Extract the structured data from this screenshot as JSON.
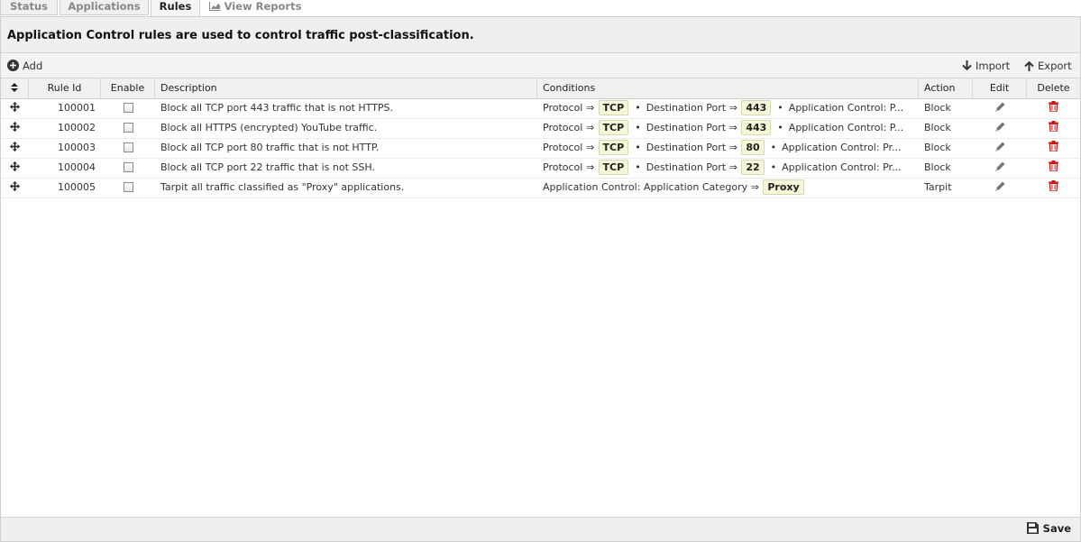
{
  "tabs": [
    {
      "label": "Status"
    },
    {
      "label": "Applications"
    },
    {
      "label": "Rules"
    },
    {
      "label": "View Reports",
      "icon": "chart-icon"
    }
  ],
  "banner": {
    "text": "Application Control rules are used to control traffic post-classification."
  },
  "toolbar": {
    "add": "Add",
    "import": "Import",
    "export": "Export"
  },
  "grid": {
    "columns": [
      "Rule Id",
      "Enable",
      "Description",
      "Conditions",
      "Action",
      "Edit",
      "Delete"
    ],
    "rows": [
      {
        "id": "100001",
        "desc": "Block all TCP port 443 traffic that is not HTTPS.",
        "c1": "Protocol ⇒",
        "v1": "TCP",
        "c2": "Destination Port ⇒",
        "v2": "443",
        "c3": "Application Control: P...",
        "action": "Block"
      },
      {
        "id": "100002",
        "desc": "Block all HTTPS (encrypted) YouTube traffic.",
        "c1": "Protocol ⇒",
        "v1": "TCP",
        "c2": "Destination Port ⇒",
        "v2": "443",
        "c3": "Application Control: P...",
        "action": "Block"
      },
      {
        "id": "100003",
        "desc": "Block all TCP port 80 traffic that is not HTTP.",
        "c1": "Protocol ⇒",
        "v1": "TCP",
        "c2": "Destination Port ⇒",
        "v2": "80",
        "c3": "Application Control: Pr...",
        "action": "Block"
      },
      {
        "id": "100004",
        "desc": "Block all TCP port 22 traffic that is not SSH.",
        "c1": "Protocol ⇒",
        "v1": "TCP",
        "c2": "Destination Port ⇒",
        "v2": "22",
        "c3": "Application Control: Pr...",
        "action": "Block"
      },
      {
        "id": "100005",
        "desc": "Tarpit all traffic classified as \"Proxy\" applications.",
        "c1": "Application Control: Application Category ⇒",
        "v1": "Proxy",
        "action": "Tarpit"
      }
    ]
  },
  "footer": {
    "save": "Save"
  },
  "colors": {
    "delete_icon": "#cc1111",
    "tag_bg": "#f6f6d8"
  }
}
